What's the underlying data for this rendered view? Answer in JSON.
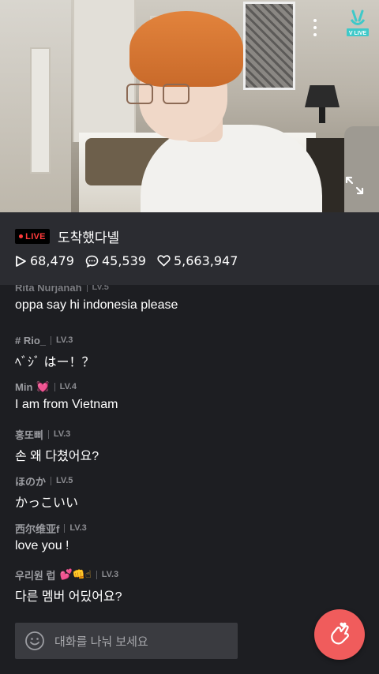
{
  "video": {
    "logo_text": "V LIVE",
    "icons": [
      "more-vertical-icon",
      "vlive-logo-icon",
      "fullscreen-icon"
    ]
  },
  "broadcast": {
    "live_label": "LIVE",
    "title": "도착했다녤",
    "views": "68,479",
    "comments": "45,539",
    "hearts": "5,663,947",
    "live_color": "#ff3b3b"
  },
  "chat": {
    "messages": [
      {
        "user": "Rita Nurjanah",
        "level": "LV.5",
        "text": "oppa say hi indonesia please"
      },
      {
        "user": "# Rio_",
        "level": "LV.3",
        "text": "ﾍﾞｼﾞ はー！？"
      },
      {
        "user": "Min",
        "emoji": "💓",
        "level": "LV.4",
        "text": "I am from Vietnam"
      },
      {
        "user": "홍또삐",
        "level": "LV.3",
        "text": "손 왜 다쳤어요?"
      },
      {
        "user": "ほのか",
        "level": "LV.5",
        "text": "かっこいい"
      },
      {
        "user": "西尔维亚f",
        "level": "LV.3",
        "text": "love you !"
      },
      {
        "user": "우리원 럽",
        "emoji": "💕👊☝",
        "level": "LV.3",
        "text": "다른 멤버 어딨어요?"
      }
    ]
  },
  "composer": {
    "placeholder": "대화를 나눠 보세요",
    "heart_button_color": "#f05c5c"
  }
}
